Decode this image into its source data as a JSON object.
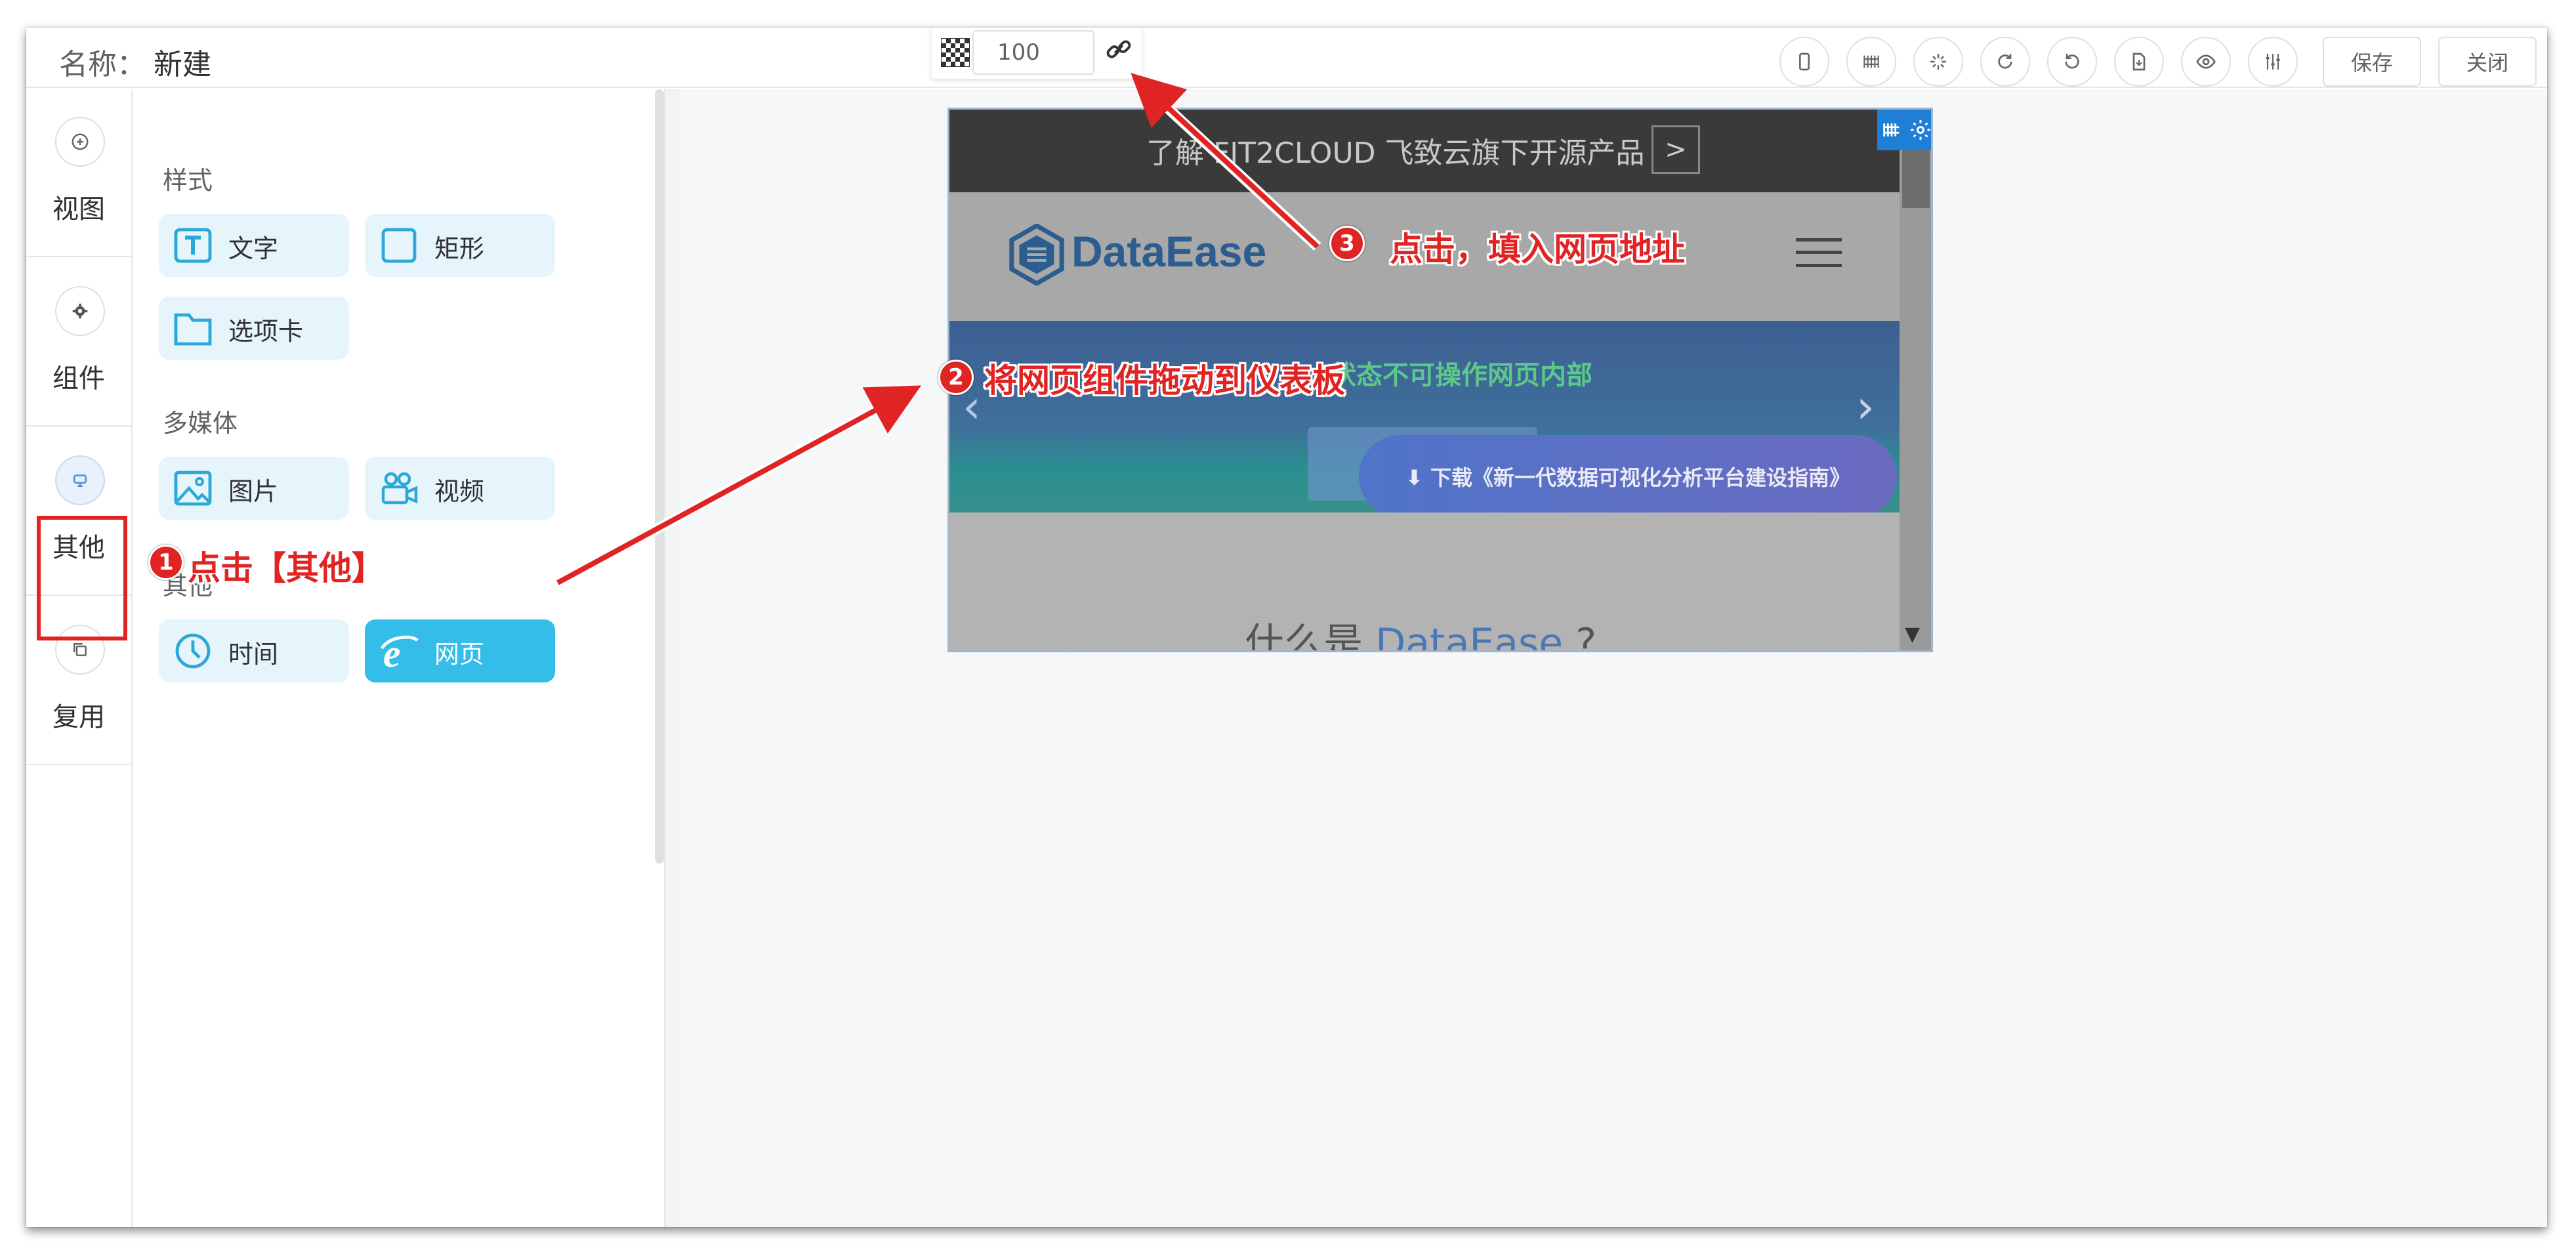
{
  "header": {
    "name_label": "名称：",
    "name_value": "新建",
    "opacity_value": "100",
    "save_label": "保存",
    "close_label": "关闭",
    "toolbar_icons": [
      "mobile-icon",
      "grid-icon",
      "magic-icon",
      "redo-icon",
      "undo-icon",
      "export-icon",
      "preview-eye-icon",
      "adjust-icon"
    ]
  },
  "rail": {
    "items": [
      {
        "label": "视图",
        "icon": "plus-circle-icon"
      },
      {
        "label": "组件",
        "icon": "gear-icon"
      },
      {
        "label": "其他",
        "icon": "other-icon"
      },
      {
        "label": "复用",
        "icon": "copy-icon"
      }
    ]
  },
  "panel": {
    "style_title": "样式",
    "style_items": [
      {
        "label": "文字",
        "icon": "text-icon"
      },
      {
        "label": "矩形",
        "icon": "rectangle-icon"
      },
      {
        "label": "选项卡",
        "icon": "tab-folder-icon"
      }
    ],
    "media_title": "多媒体",
    "media_items": [
      {
        "label": "图片",
        "icon": "image-icon"
      },
      {
        "label": "视频",
        "icon": "video-icon"
      }
    ],
    "other_title": "其他",
    "other_items": [
      {
        "label": "时间",
        "icon": "clock-icon"
      },
      {
        "label": "网页",
        "icon": "ie-browser-icon"
      }
    ]
  },
  "webpage_preview": {
    "top_banner": "了解 FIT2CLOUD 飞致云旗下开源产品",
    "top_banner_btn": ">",
    "logo_text": "DataEase",
    "banner_green": "状态不可操作网页内部",
    "banner_button": "⬇ 下载《新一代数据可视化分析平台建设指南》",
    "lower_text_prefix": "什么是 ",
    "lower_text_brand": "DataEase",
    "lower_text_suffix": " ?"
  },
  "annotations": {
    "step1_num": "1",
    "step1_text": "点击【其他】",
    "step2_num": "2",
    "step2_text": "将网页组件拖动到仪表板",
    "step3_num": "3",
    "step3_text": "点击，填入网页地址"
  },
  "colors": {
    "accent_blue": "#33bde8",
    "annotation_red": "#e02424",
    "canvas_bg": "#f6f7f9",
    "chip_bg": "#e6f4fc"
  }
}
